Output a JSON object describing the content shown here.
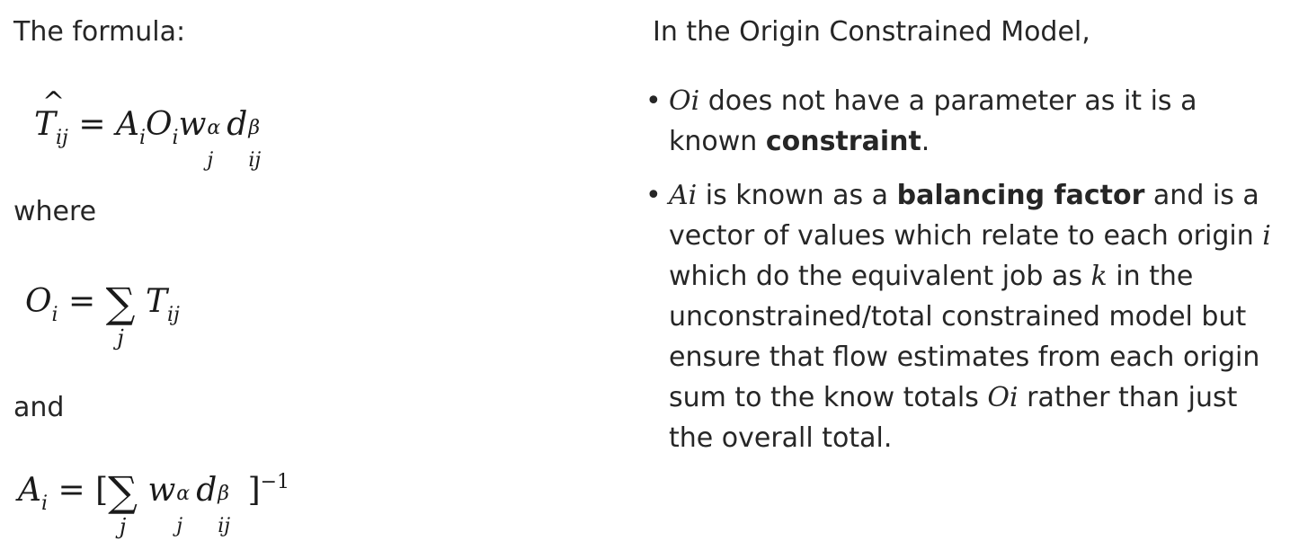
{
  "left": {
    "label_formula": "The formula:",
    "label_where": "where",
    "label_and": "and"
  },
  "right": {
    "intro": "In the Origin Constrained Model,",
    "bullet1": {
      "var": "Oi",
      "text_before_bold": " does not have a parameter as it is a known ",
      "bold": "constraint",
      "text_after_bold": "."
    },
    "bullet2": {
      "var": "Ai",
      "text1": " is known as a ",
      "bold": "balancing factor",
      "text2": " and is a vector of values which relate to each origin ",
      "var_i": "i",
      "text3": " which do the equivalent job as ",
      "var_k": "k",
      "text4": " in the unconstrained/total constrained model but ensure that flow estimates from each origin sum to the know totals ",
      "var_oi": "Oi",
      "text5": " rather than just the overall total."
    },
    "bullet_char": "•"
  }
}
